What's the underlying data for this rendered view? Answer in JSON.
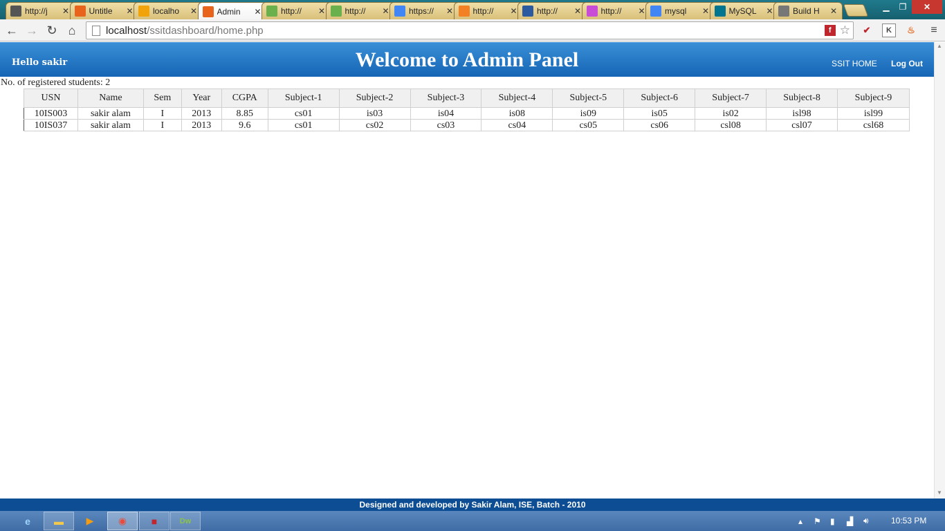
{
  "browser": {
    "tabs": [
      {
        "title": "http://j",
        "icon": "cloud-icon",
        "active": false
      },
      {
        "title": "Untitle",
        "icon": "xampp-icon",
        "active": false
      },
      {
        "title": "localho",
        "icon": "phpmyadmin-icon",
        "active": false
      },
      {
        "title": "Admin",
        "icon": "xampp-icon",
        "active": true
      },
      {
        "title": "http://",
        "icon": "w3schools-icon",
        "active": false
      },
      {
        "title": "http://",
        "icon": "w3schools-icon",
        "active": false
      },
      {
        "title": "https://",
        "icon": "google-icon",
        "active": false
      },
      {
        "title": "http://",
        "icon": "stackoverflow-icon",
        "active": false
      },
      {
        "title": "http://",
        "icon": "page-icon",
        "active": false
      },
      {
        "title": "http://",
        "icon": "color-wheel-icon",
        "active": false
      },
      {
        "title": "mysql",
        "icon": "google-icon",
        "active": false
      },
      {
        "title": "MySQL",
        "icon": "mysql-icon",
        "active": false
      },
      {
        "title": "Build H",
        "icon": "chrome-dev-icon",
        "active": false
      }
    ],
    "url_host": "localhost",
    "url_path": "/ssitdashboard/home.php"
  },
  "header": {
    "greeting": "Hello sakir",
    "title": "Welcome to Admin Panel",
    "nav_home": "SSIT HOME",
    "nav_logout": "Log Out"
  },
  "main": {
    "count_label": "No. of registered students: 2",
    "columns": [
      "USN",
      "Name",
      "Sem",
      "Year",
      "CGPA",
      "Subject-1",
      "Subject-2",
      "Subject-3",
      "Subject-4",
      "Subject-5",
      "Subject-6",
      "Subject-7",
      "Subject-8",
      "Subject-9"
    ],
    "rows": [
      [
        "10IS003",
        "sakir alam",
        "I",
        "2013",
        "8.85",
        "cs01",
        "is03",
        "is04",
        "is08",
        "is09",
        "is05",
        "is02",
        "isl98",
        "isl99"
      ],
      [
        "10IS037",
        "sakir alam",
        "I",
        "2013",
        "9.6",
        "cs01",
        "cs02",
        "cs03",
        "cs04",
        "cs05",
        "cs06",
        "csl08",
        "csl07",
        "csl68"
      ]
    ]
  },
  "footer": {
    "text": "Designed and developed by Sakir Alam, ISE, Batch - 2010"
  },
  "taskbar": {
    "clock": "10:53 PM"
  },
  "colors": {
    "header_top": "#3a8fd6",
    "header_bottom": "#1565b5",
    "footer": "#0d4d93",
    "table_header_bg": "#f0f0f0"
  }
}
